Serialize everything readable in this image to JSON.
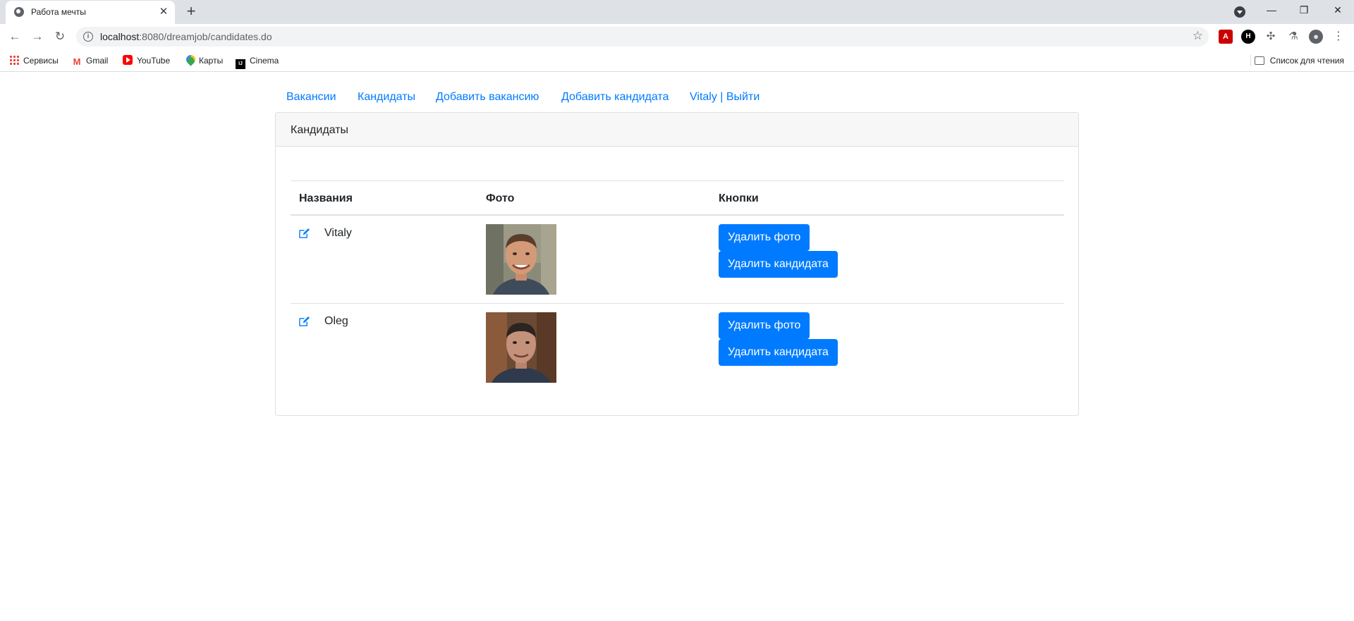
{
  "browser": {
    "tab_title": "Работа мечты",
    "tab_close": "✕",
    "new_tab": "+",
    "url_host": "localhost",
    "url_path": ":8080/dreamjob/candidates.do",
    "win_minimize": "—",
    "win_restore": "❐",
    "win_close": "✕",
    "back": "←",
    "forward": "→",
    "reload": "↻",
    "info": "i",
    "star": "☆",
    "menu": "⋮"
  },
  "bookmarks": [
    {
      "label": "Сервисы",
      "icon": "apps-icon"
    },
    {
      "label": "Gmail",
      "icon": "gmail-icon"
    },
    {
      "label": "YouTube",
      "icon": "youtube-icon"
    },
    {
      "label": "Карты",
      "icon": "maps-icon"
    },
    {
      "label": "Cinema",
      "icon": "intellij-icon"
    }
  ],
  "reading_list": "Список для чтения",
  "nav": {
    "vacancies": "Вакансии",
    "candidates": "Кандидаты",
    "add_vacancy": "Добавить вакансию",
    "add_candidate": "Добавить кандидата",
    "user_logout": "Vitaly | Выйти"
  },
  "card": {
    "title": "Кандидаты",
    "columns": [
      "Названия",
      "Фото",
      "Кнопки"
    ],
    "rows": [
      {
        "name": "Vitaly",
        "delete_photo": "Удалить фото",
        "delete_candidate": "Удалить кандидата"
      },
      {
        "name": "Oleg",
        "delete_photo": "Удалить фото",
        "delete_candidate": "Удалить кандидата"
      }
    ]
  },
  "colors": {
    "link": "#007bff",
    "button": "#007bff"
  }
}
